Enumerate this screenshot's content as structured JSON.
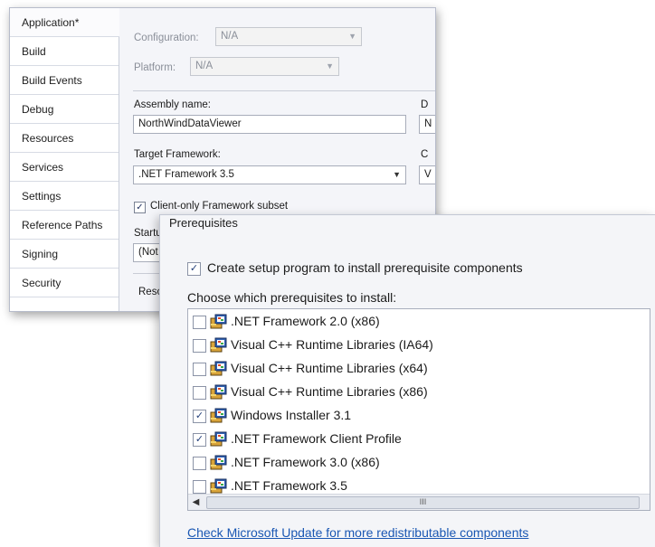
{
  "sidebar": {
    "items": [
      {
        "label": "Application*"
      },
      {
        "label": "Build"
      },
      {
        "label": "Build Events"
      },
      {
        "label": "Debug"
      },
      {
        "label": "Resources"
      },
      {
        "label": "Services"
      },
      {
        "label": "Settings"
      },
      {
        "label": "Reference Paths"
      },
      {
        "label": "Signing"
      },
      {
        "label": "Security"
      }
    ]
  },
  "app": {
    "configuration_label": "Configuration:",
    "configuration_value": "N/A",
    "platform_label": "Platform:",
    "platform_value": "N/A",
    "assembly_label": "Assembly name:",
    "assembly_value": "NorthWindDataViewer",
    "target_label": "Target Framework:",
    "target_value": ".NET Framework 3.5",
    "client_only_label": "Client-only Framework subset",
    "startup_label": "Startup",
    "startup_value": "(Not s",
    "resources_label": "Resou",
    "right_col_1": "D",
    "right_col_2": "N",
    "right_col_3": "C",
    "right_col_4": "V"
  },
  "prereq": {
    "title": "Prerequisites",
    "create_setup_label": "Create setup program to install prerequisite components",
    "choose_label": "Choose which prerequisites to install:",
    "items": [
      {
        "label": ".NET Framework 2.0 (x86)",
        "checked": false
      },
      {
        "label": "Visual C++ Runtime Libraries (IA64)",
        "checked": false
      },
      {
        "label": "Visual C++ Runtime Libraries (x64)",
        "checked": false
      },
      {
        "label": "Visual C++ Runtime Libraries (x86)",
        "checked": false
      },
      {
        "label": "Windows Installer 3.1",
        "checked": true
      },
      {
        "label": ".NET Framework Client Profile",
        "checked": true
      },
      {
        "label": ".NET Framework 3.0 (x86)",
        "checked": false
      },
      {
        "label": ".NET Framework 3.5",
        "checked": false
      }
    ],
    "scroll_grip": "III",
    "link_text": "Check Microsoft Update for more redistributable components"
  },
  "icons": {
    "package": "package-icon",
    "checkmark": "✓"
  }
}
